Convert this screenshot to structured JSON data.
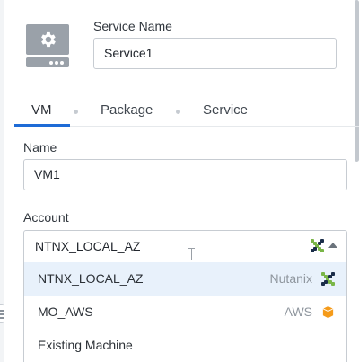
{
  "service": {
    "name_label": "Service Name",
    "name_value": "Service1",
    "icon": "service-icon"
  },
  "tabs": [
    {
      "label": "VM",
      "active": true
    },
    {
      "label": "Package",
      "active": false
    },
    {
      "label": "Service",
      "active": false
    }
  ],
  "vm": {
    "name_label": "Name",
    "name_value": "VM1",
    "account_label": "Account",
    "account_value": "NTNX_LOCAL_AZ",
    "account_icon": "nutanix-icon",
    "dropdown_state": "open",
    "options": [
      {
        "label": "NTNX_LOCAL_AZ",
        "provider": "Nutanix",
        "icon": "nutanix-icon",
        "highlighted": true
      },
      {
        "label": "MO_AWS",
        "provider": "AWS",
        "icon": "aws-icon",
        "highlighted": false
      },
      {
        "label": "Existing Machine",
        "provider": "",
        "icon": "",
        "highlighted": false
      }
    ]
  },
  "colors": {
    "accent": "#1e6bd6",
    "highlight": "#e8f1fb",
    "nutanix_green": "#7ab648",
    "nutanix_navy": "#1a2d49",
    "aws_orange": "#f59b1a"
  }
}
